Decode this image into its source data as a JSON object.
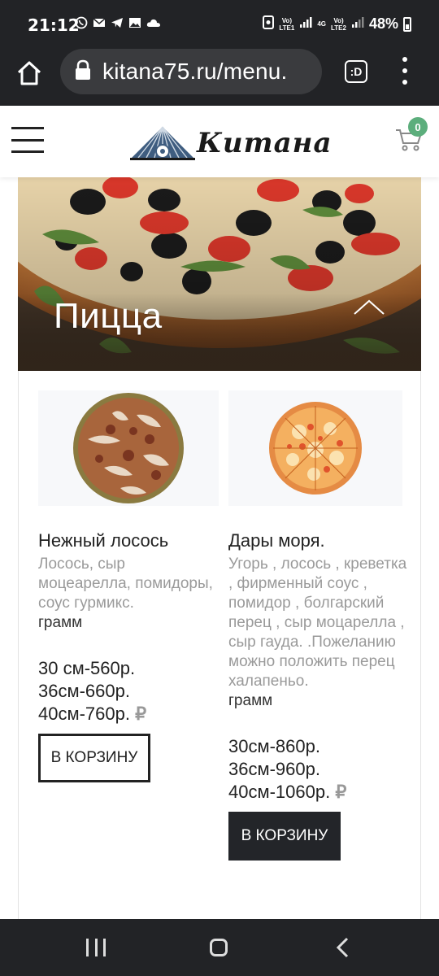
{
  "status_bar": {
    "time": "21:12",
    "net1": "Vo)\nLTE1",
    "net_type": "4G",
    "net2": "Vo)\nLTE2",
    "battery": "48%"
  },
  "browser": {
    "url": "kitana75.ru/menu.",
    "tab_label": ":D"
  },
  "header": {
    "logo_text": "Китана",
    "cart_count": "0"
  },
  "category": {
    "title": "Пицца"
  },
  "products": [
    {
      "name": "Нежный лосось",
      "description": "Лосось, сыр моцеарелла, помидоры, соус гурмикс.",
      "weight": "грамм",
      "prices": [
        "30 см-560р.",
        "36см-660р.",
        "40см-760р."
      ],
      "currency": "₽",
      "button": "В КОРЗИНУ"
    },
    {
      "name": "Дары моря.",
      "description": "Угорь , лосось , креветка , фирменный соус , помидор , болгарский перец , сыр моцарелла , сыр гауда. .Пожеланию можно положить перец халапеньо.",
      "weight": "грамм",
      "prices": [
        "30см-860р.",
        "36см-960р.",
        "40см-1060р."
      ],
      "currency": "₽",
      "button": "В КОРЗИНУ"
    }
  ],
  "colors": {
    "system_bar": "#222326",
    "badge": "#5cae7c",
    "button_dark": "#232529"
  },
  "icons": {
    "home": "home-icon",
    "lock": "lock-icon",
    "tabs": "tab-switcher-icon",
    "overflow": "more-vert-icon",
    "hamburger": "hamburger-icon",
    "cart": "cart-icon",
    "collapse": "chevron-up-icon"
  }
}
